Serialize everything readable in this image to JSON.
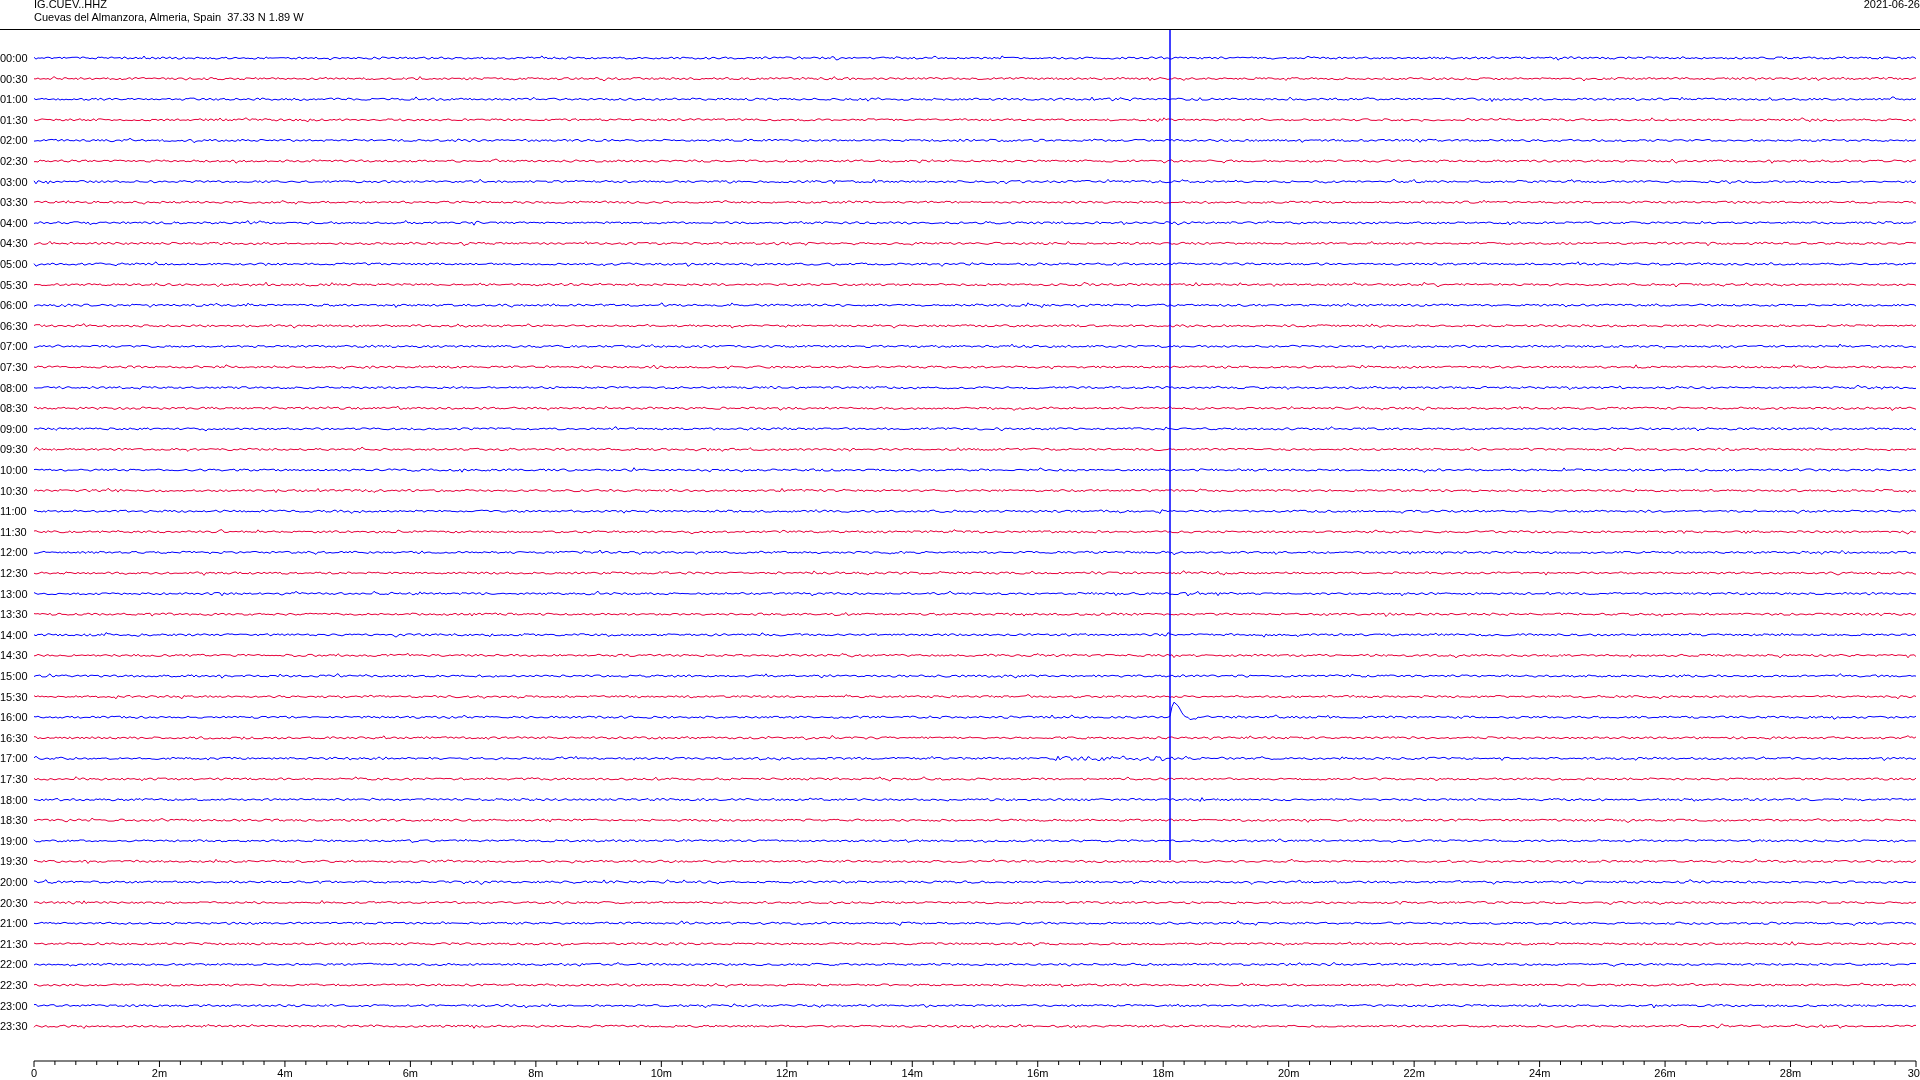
{
  "header": {
    "station": "IG.CUEV..HHZ",
    "location": "Cuevas del Almanzora, Almeria, Spain  37.33 N 1.89 W",
    "date": "2021-06-26"
  },
  "rows": [
    {
      "time": "00:00",
      "color": "#0000ff"
    },
    {
      "time": "00:30",
      "color": "#e6003a"
    },
    {
      "time": "01:00",
      "color": "#0000ff"
    },
    {
      "time": "01:30",
      "color": "#e6003a"
    },
    {
      "time": "02:00",
      "color": "#0000ff"
    },
    {
      "time": "02:30",
      "color": "#e6003a"
    },
    {
      "time": "03:00",
      "color": "#0000ff"
    },
    {
      "time": "03:30",
      "color": "#e6003a"
    },
    {
      "time": "04:00",
      "color": "#0000ff"
    },
    {
      "time": "04:30",
      "color": "#e6003a"
    },
    {
      "time": "05:00",
      "color": "#0000ff"
    },
    {
      "time": "05:30",
      "color": "#e6003a"
    },
    {
      "time": "06:00",
      "color": "#0000ff"
    },
    {
      "time": "06:30",
      "color": "#e6003a"
    },
    {
      "time": "07:00",
      "color": "#0000ff"
    },
    {
      "time": "07:30",
      "color": "#e6003a"
    },
    {
      "time": "08:00",
      "color": "#0000ff"
    },
    {
      "time": "08:30",
      "color": "#e6003a"
    },
    {
      "time": "09:00",
      "color": "#0000ff"
    },
    {
      "time": "09:30",
      "color": "#e6003a"
    },
    {
      "time": "10:00",
      "color": "#0000ff"
    },
    {
      "time": "10:30",
      "color": "#e6003a"
    },
    {
      "time": "11:00",
      "color": "#0000ff"
    },
    {
      "time": "11:30",
      "color": "#e6003a"
    },
    {
      "time": "12:00",
      "color": "#0000ff"
    },
    {
      "time": "12:30",
      "color": "#e6003a"
    },
    {
      "time": "13:00",
      "color": "#0000ff"
    },
    {
      "time": "13:30",
      "color": "#e6003a"
    },
    {
      "time": "14:00",
      "color": "#0000ff"
    },
    {
      "time": "14:30",
      "color": "#e6003a"
    },
    {
      "time": "15:00",
      "color": "#0000ff"
    },
    {
      "time": "15:30",
      "color": "#e6003a"
    },
    {
      "time": "16:00",
      "color": "#0000ff"
    },
    {
      "time": "16:30",
      "color": "#e6003a"
    },
    {
      "time": "17:00",
      "color": "#0000ff"
    },
    {
      "time": "17:30",
      "color": "#e6003a"
    },
    {
      "time": "18:00",
      "color": "#0000ff"
    },
    {
      "time": "18:30",
      "color": "#e6003a"
    },
    {
      "time": "19:00",
      "color": "#0000ff"
    },
    {
      "time": "19:30",
      "color": "#e6003a"
    },
    {
      "time": "20:00",
      "color": "#0000ff"
    },
    {
      "time": "20:30",
      "color": "#e6003a"
    },
    {
      "time": "21:00",
      "color": "#0000ff"
    },
    {
      "time": "21:30",
      "color": "#e6003a"
    },
    {
      "time": "22:00",
      "color": "#0000ff"
    },
    {
      "time": "22:30",
      "color": "#e6003a"
    },
    {
      "time": "23:00",
      "color": "#0000ff"
    },
    {
      "time": "23:30",
      "color": "#e6003a"
    }
  ],
  "x_axis": {
    "labels": [
      "0",
      "2m",
      "4m",
      "6m",
      "8m",
      "10m",
      "12m",
      "14m",
      "16m",
      "18m",
      "20m",
      "22m",
      "24m",
      "26m",
      "28m",
      "30"
    ]
  }
}
